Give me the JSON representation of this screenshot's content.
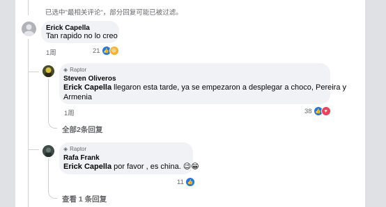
{
  "notice": "已选中\"最相关评论\"，部分回复可能已被过滤。",
  "comments": [
    {
      "author": "Erick Capella",
      "text": "Tan rapido no lo creo",
      "time": "1周",
      "reactions": "21",
      "reaction_icons": [
        "like-icon",
        "haha-icon"
      ]
    }
  ],
  "replies": [
    {
      "badge": "Raptor",
      "author": "Steven Oliveros",
      "mention": "Erick Capella",
      "text_line1": " llegaron esta tarde, ya se empezaron a desplegar a choco, Pereira y",
      "text_line2": "Armenia",
      "time": "1周",
      "reactions": "38",
      "reaction_icons": [
        "like-icon",
        "heart-icon"
      ],
      "more_replies": "全部2条回复"
    },
    {
      "badge": "Raptor",
      "author": "Rafa Frank",
      "mention": "Erick Capella",
      "text": " por favor , es china. 😉😁",
      "reactions": "11",
      "reaction_icons": [
        "like-icon"
      ],
      "more_replies": "查看 1 条回复"
    }
  ],
  "colors": {
    "like": "#1877f2",
    "heart": "#f33e58",
    "haha": "#f7b125",
    "bubble": "#f0f2f5",
    "muted": "#65676b"
  }
}
